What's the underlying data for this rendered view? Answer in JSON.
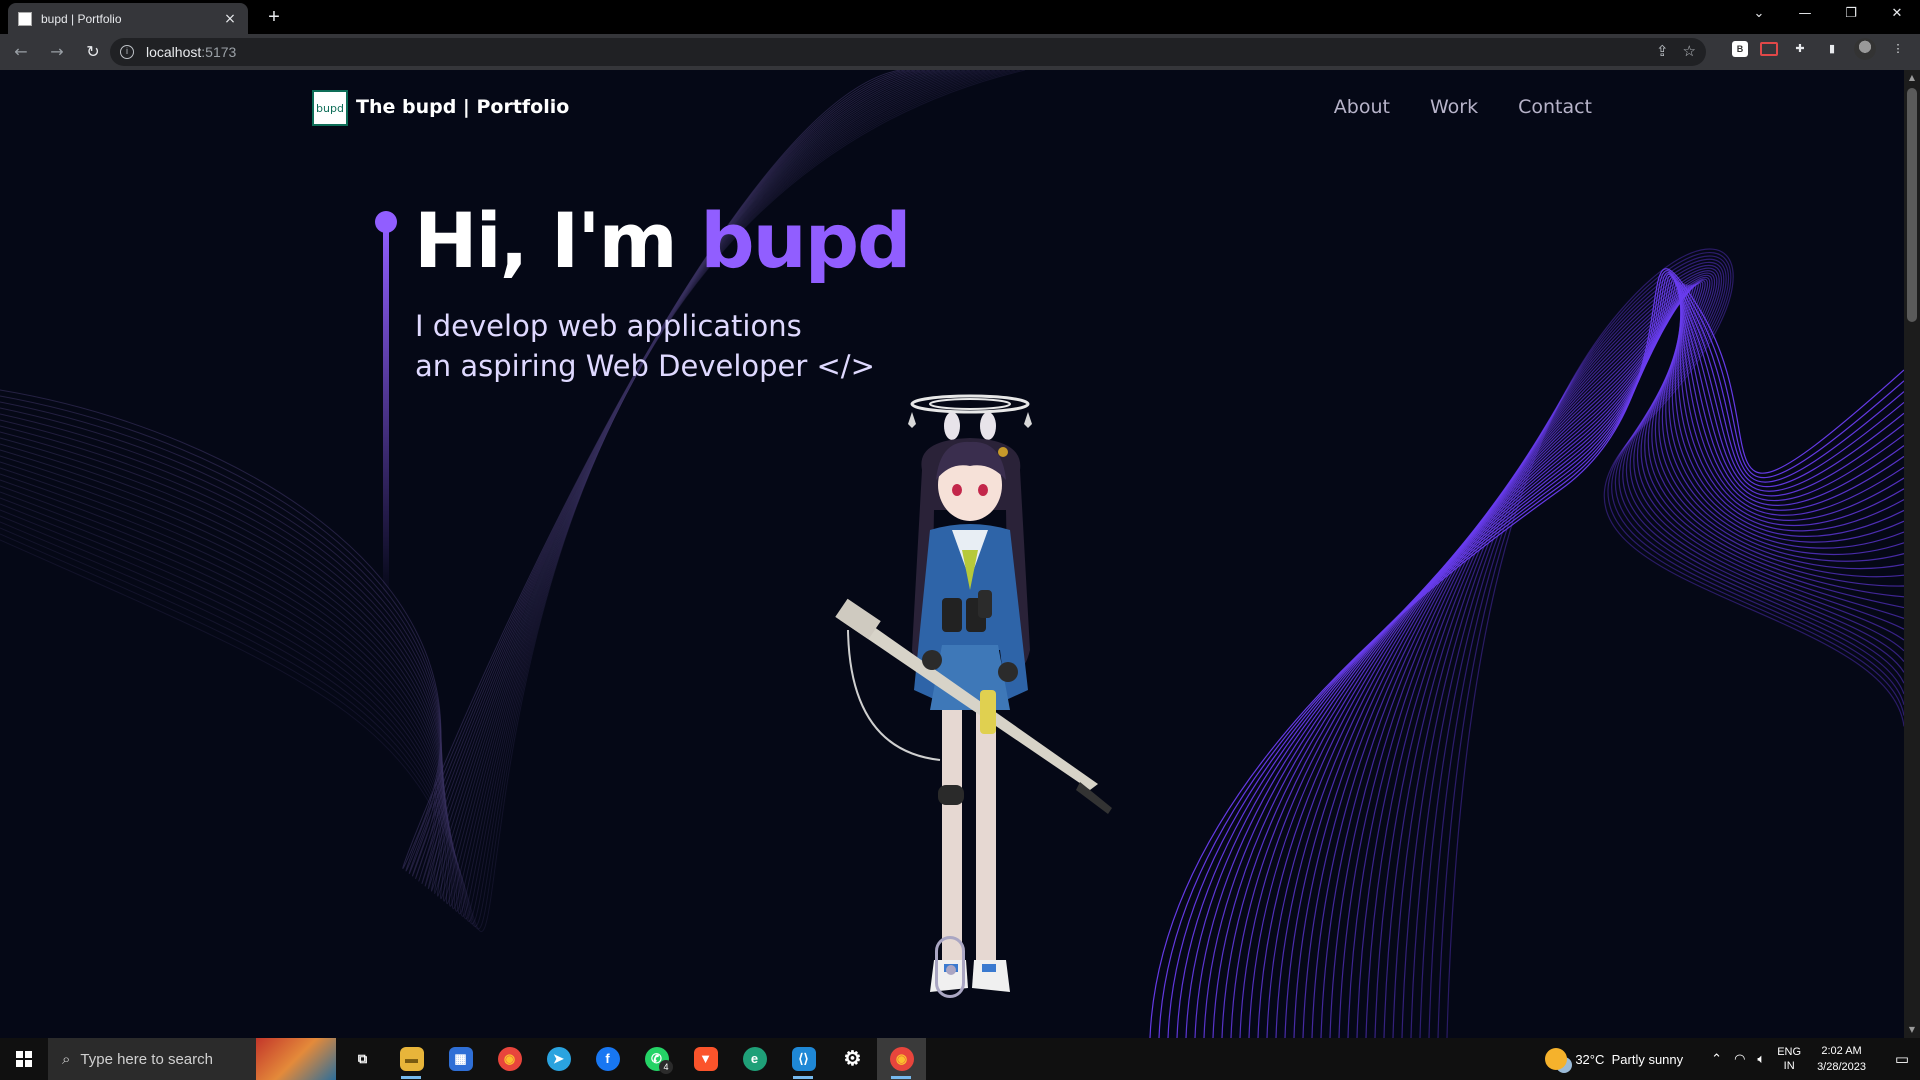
{
  "browser": {
    "tab_title": "bupd | Portfolio",
    "tab_close": "×",
    "new_tab": "+",
    "url_host": "localhost",
    "url_port": ":5173",
    "window_controls": {
      "dropdown": "⌄",
      "minimize": "—",
      "restore": "❐",
      "close": "✕"
    }
  },
  "site": {
    "logo_text": "bupd",
    "brand": "The bupd | Portfolio",
    "nav": [
      "About",
      "Work",
      "Contact"
    ],
    "hero": {
      "greeting": "Hi, I'm ",
      "name": "bupd",
      "line1": "I develop web applications",
      "line2": "an aspiring Web Developer </>"
    },
    "accent": "#915eff",
    "background": "#050816"
  },
  "taskbar": {
    "search_placeholder": "Type here to search",
    "apps": [
      {
        "name": "task-view",
        "label": "⧉"
      },
      {
        "name": "file-explorer",
        "label": "▬"
      },
      {
        "name": "microsoft-store",
        "label": "▦"
      },
      {
        "name": "chrome",
        "label": "◉"
      },
      {
        "name": "telegram",
        "label": "➤"
      },
      {
        "name": "facebook",
        "label": "f"
      },
      {
        "name": "whatsapp",
        "label": "✆",
        "badge": "4"
      },
      {
        "name": "brave",
        "label": "▼"
      },
      {
        "name": "edge",
        "label": "e"
      },
      {
        "name": "vscode",
        "label": "⟨⟩"
      },
      {
        "name": "settings",
        "label": "⚙"
      },
      {
        "name": "chrome-active",
        "label": "◉"
      }
    ],
    "weather_temp": "32°C",
    "weather_desc": "Partly sunny",
    "lang_1": "ENG",
    "lang_2": "IN",
    "time": "2:02 AM",
    "date": "3/28/2023"
  }
}
